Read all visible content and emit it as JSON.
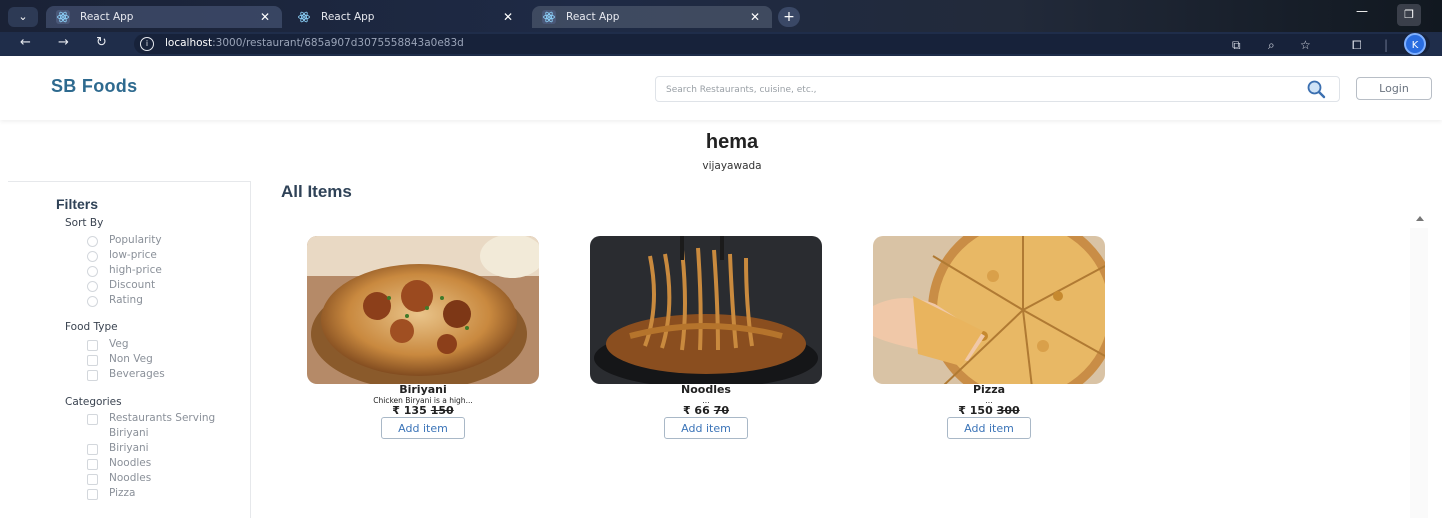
{
  "browser": {
    "tabs": [
      {
        "title": "React App",
        "active": false
      },
      {
        "title": "React App",
        "active": true
      },
      {
        "title": "React App",
        "active": false
      }
    ],
    "url_host": "localhost",
    "url_path": ":3000/restaurant/685a907d3075558843a0e83d",
    "profile_initial": "K"
  },
  "header": {
    "logo": "SB Foods",
    "search_placeholder": "Search Restaurants, cuisine, etc.,",
    "login_label": "Login"
  },
  "restaurant": {
    "name": "hema",
    "city": "vijayawada"
  },
  "filters": {
    "title": "Filters",
    "sort_by": {
      "title": "Sort By",
      "options": [
        "Popularity",
        "low-price",
        "high-price",
        "Discount",
        "Rating"
      ]
    },
    "food_type": {
      "title": "Food Type",
      "options": [
        "Veg",
        "Non Veg",
        "Beverages"
      ]
    },
    "categories": {
      "title": "Categories",
      "options": [
        "Restaurants Serving",
        "Biriyani",
        "Biriyani",
        "Noodles",
        "Noodles",
        "Pizza"
      ]
    }
  },
  "items": {
    "title": "All Items",
    "list": [
      {
        "name": "Biriyani",
        "desc": "Chicken Biryani is a high...",
        "price": "₹ 135",
        "old_price": "150",
        "button": "Add item"
      },
      {
        "name": "Noodles",
        "desc": "...",
        "price": "₹ 66",
        "old_price": "70",
        "button": "Add item"
      },
      {
        "name": "Pizza",
        "desc": "...",
        "price": "₹ 150",
        "old_price": "300",
        "button": "Add item"
      }
    ]
  },
  "colors": {
    "brand": "#2e6a8f",
    "button_text": "#3b74b8",
    "chrome_bg": "#1f2d4a"
  }
}
